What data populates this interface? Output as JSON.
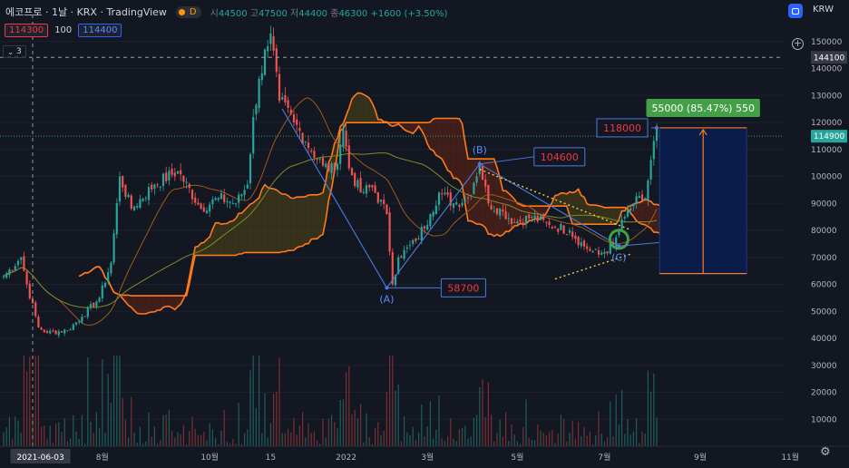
{
  "header": {
    "title": "에코프로 · 1날 · KRX · TradingView",
    "market_badge": "D",
    "ohlc": [
      {
        "label": "시",
        "value": "44500"
      },
      {
        "label": "고",
        "value": "47500"
      },
      {
        "label": "저",
        "value": "44400"
      },
      {
        "label": "종",
        "value": "46300"
      }
    ],
    "change": "+1600 (+3.50%)",
    "currency": "KRW",
    "bid": "114300",
    "spread": "100",
    "ask": "114400",
    "indicator_count": "3"
  },
  "colors": {
    "background": "#131722",
    "up": "#26a69a",
    "down": "#ef5350",
    "cloud_line": "#ff7a1a",
    "wave_line": "#4a7be0",
    "target_box": "#0a1d4a",
    "target_label": "#43a047"
  },
  "chart_data": {
    "type": "candlestick",
    "title": "",
    "ylim": [
      0,
      160000
    ],
    "y_ticks": [
      10000,
      20000,
      30000,
      40000,
      50000,
      60000,
      70000,
      80000,
      90000,
      100000,
      110000,
      120000,
      130000,
      140000,
      150000
    ],
    "x_ticks": [
      {
        "label": "2021-06-03",
        "bar": 3
      },
      {
        "label": "8월",
        "bar": 34
      },
      {
        "label": "10월",
        "bar": 71
      },
      {
        "label": "15",
        "bar": 92
      },
      {
        "label": "2022",
        "bar": 118
      },
      {
        "label": "3월",
        "bar": 146
      },
      {
        "label": "5월",
        "bar": 177
      },
      {
        "label": "7월",
        "bar": 207
      },
      {
        "label": "9월",
        "bar": 240
      },
      {
        "label": "11월",
        "bar": 271
      }
    ],
    "anchors": [
      [
        0,
        63000
      ],
      [
        6,
        70000
      ],
      [
        8,
        60000
      ],
      [
        12,
        44000
      ],
      [
        15,
        42000
      ],
      [
        22,
        43000
      ],
      [
        27,
        48000
      ],
      [
        33,
        55000
      ],
      [
        37,
        68000
      ],
      [
        40,
        100000
      ],
      [
        44,
        88000
      ],
      [
        52,
        97000
      ],
      [
        60,
        102000
      ],
      [
        68,
        88000
      ],
      [
        74,
        92000
      ],
      [
        80,
        90000
      ],
      [
        84,
        97000
      ],
      [
        86,
        122000
      ],
      [
        90,
        147000
      ],
      [
        92,
        153000
      ],
      [
        95,
        128000
      ],
      [
        100,
        120000
      ],
      [
        104,
        113000
      ],
      [
        110,
        104000
      ],
      [
        114,
        102000
      ],
      [
        117,
        118000
      ],
      [
        119,
        103000
      ],
      [
        123,
        94000
      ],
      [
        127,
        96000
      ],
      [
        132,
        86000
      ],
      [
        134,
        60000
      ],
      [
        136,
        70000
      ],
      [
        142,
        76000
      ],
      [
        147,
        86000
      ],
      [
        150,
        94000
      ],
      [
        155,
        90000
      ],
      [
        160,
        92000
      ],
      [
        164,
        104600
      ],
      [
        167,
        90000
      ],
      [
        172,
        87000
      ],
      [
        176,
        83000
      ],
      [
        182,
        85000
      ],
      [
        188,
        82000
      ],
      [
        195,
        80000
      ],
      [
        200,
        74000
      ],
      [
        205,
        71000
      ],
      [
        210,
        74200
      ],
      [
        214,
        85000
      ],
      [
        217,
        90000
      ],
      [
        221,
        92000
      ],
      [
        225,
        118000
      ]
    ],
    "wave_points": [
      {
        "label": "(A)",
        "bar": 132,
        "price": 58700,
        "price_label": "58700"
      },
      {
        "label": "(B)",
        "bar": 164,
        "price": 104600,
        "price_label": "104600"
      },
      {
        "label": "(C)",
        "bar": 212,
        "price": 74200,
        "price_label": "74200"
      }
    ],
    "target": {
      "price_label": "118000",
      "price": 118000,
      "box_top": 118000,
      "box_bottom": 64000,
      "bar_start": 226,
      "bar_end": 256,
      "stat_label": "55000 (85.47%) 550"
    },
    "last_price": "114900",
    "last_price_value": 114900,
    "crosshair_price": "144100",
    "crosshair_price_value": 144100,
    "crosshair_bar": 10,
    "volume_ylim": [
      0,
      160000
    ]
  }
}
